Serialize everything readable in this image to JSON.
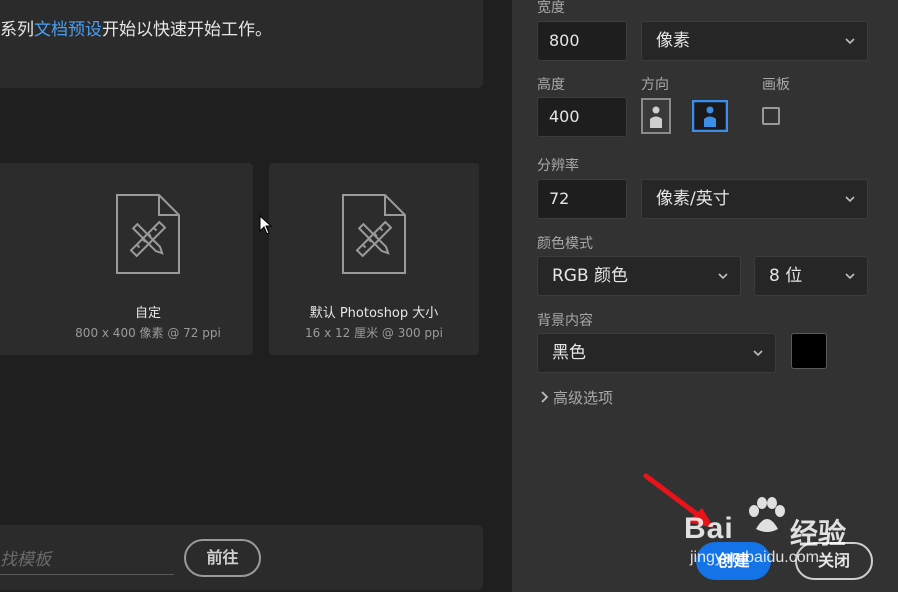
{
  "intro": {
    "prefix": "系列",
    "link": "文档预设",
    "suffix": "开始以快速开始工作。"
  },
  "presets": [
    {
      "title": "自定",
      "subtitle": "800 x 400 像素 @ 72 ppi"
    },
    {
      "title": "默认 Photoshop 大小",
      "subtitle": "16 x 12 厘米 @ 300 ppi"
    }
  ],
  "template_search": {
    "placeholder": "找模板",
    "go_label": "前往"
  },
  "settings": {
    "width_label": "宽度",
    "width_value": "800",
    "width_unit": "像素",
    "height_label": "高度",
    "height_value": "400",
    "orientation_label": "方向",
    "artboard_label": "画板",
    "resolution_label": "分辨率",
    "resolution_value": "72",
    "resolution_unit": "像素/英寸",
    "color_mode_label": "颜色模式",
    "color_mode": "RGB 颜色",
    "bit_depth": "8 位",
    "background_label": "背景内容",
    "background_value": "黑色",
    "background_color": "#000000",
    "advanced_label": "高级选项",
    "orientation_selected": "landscape",
    "artboard_checked": false
  },
  "actions": {
    "create_label": "创建",
    "close_label": "关闭"
  },
  "watermark": {
    "brand": "Bai",
    "brand2": "经验",
    "url": "jingyan.baidu.com"
  },
  "colors": {
    "accent": "#1473e6",
    "link": "#4a9ff5",
    "arrow": "#e8141a"
  }
}
